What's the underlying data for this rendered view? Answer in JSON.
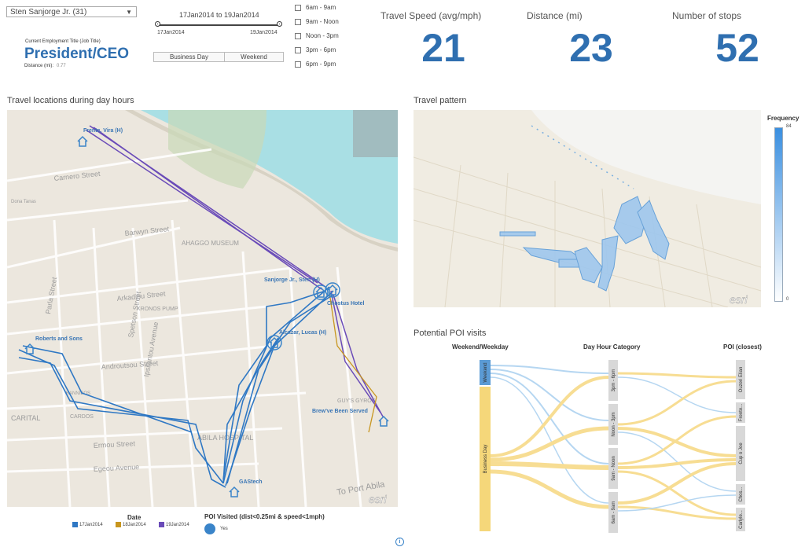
{
  "filters": {
    "employee_select": "Sten Sanjorge Jr. (31)",
    "date_range_text": "17Jan2014 to 19Jan2014",
    "slider_start": "17Jan2014",
    "slider_end": "19Jan2014",
    "day_buttons": [
      "Business Day",
      "Weekend"
    ],
    "hour_checkboxes": [
      "6am - 9am",
      "9am - Noon",
      "Noon - 3pm",
      "3pm - 6pm",
      "6pm - 9pm"
    ]
  },
  "employee": {
    "title_label": "Current Employment Title (Job Title)",
    "title_value": "President/CEO",
    "distance_label": "Distance (mi):",
    "distance_value": "0.77"
  },
  "kpis": [
    {
      "label": "Travel Speed (avg/mph)",
      "value": "21"
    },
    {
      "label": "Distance (mi)",
      "value": "23"
    },
    {
      "label": "Number of stops",
      "value": "52"
    }
  ],
  "map_panel": {
    "title": "Travel locations during day hours",
    "places": [
      "Frente, Vira (H)",
      "Sanjorge Jr., Sten (H)",
      "Chostus Hotel",
      "Roberts and Sons",
      "Alcazar, Lucas (H)",
      "Brew've Been Served",
      "GAStech"
    ],
    "streets": [
      "Barwyn Street",
      "Spetson Street",
      "Androutsou Street",
      "Arkadiou Street",
      "Ermou Street",
      "Egeou Avenue",
      "Carnero Street",
      "Parla Street",
      "Ipsilantou Avenue",
      "To Port Abila",
      "AHAGGO MUSEUM",
      "KRONOS PUMP",
      "CARDOS",
      "KANNIBOS",
      "CARITAL",
      "GUY'S GYROS",
      "ABILA HOSPITAL",
      "Dona Tanas"
    ],
    "watermark": "esri",
    "legend_date_title": "Date",
    "legend_dates": [
      {
        "label": "17Jan2014",
        "color": "#2f78c4"
      },
      {
        "label": "18Jan2014",
        "color": "#c8961e"
      },
      {
        "label": "19Jan2014",
        "color": "#6a4bb8"
      }
    ],
    "legend_poi_title": "POI Visited (dist<0.25mi & speed<1mph)",
    "legend_poi_value": "Yes",
    "poi_color": "#3a84c9"
  },
  "heat_panel": {
    "title": "Travel pattern",
    "legend_title": "Frequency",
    "legend_max": "84",
    "legend_min": "0",
    "watermark": "esri"
  },
  "flow_panel": {
    "title": "Potential POI visits",
    "col1_title": "Weekend/Weekday",
    "col2_title": "Day Hour Category",
    "col3_title": "POI (closest)",
    "col1_nodes": [
      "Weekend",
      "Business Day"
    ],
    "col2_nodes": [
      "3pm - 6pm",
      "Noon - 3pm",
      "9am - Noon",
      "6am - 9am"
    ],
    "col3_nodes": [
      "Ouzeri Elian",
      "Frente...",
      "Cup o Joe",
      "Chos...",
      "Carlyle..."
    ],
    "weekend_color": "#5b9bd5",
    "business_color": "#f5c842"
  },
  "info_icon": "i"
}
